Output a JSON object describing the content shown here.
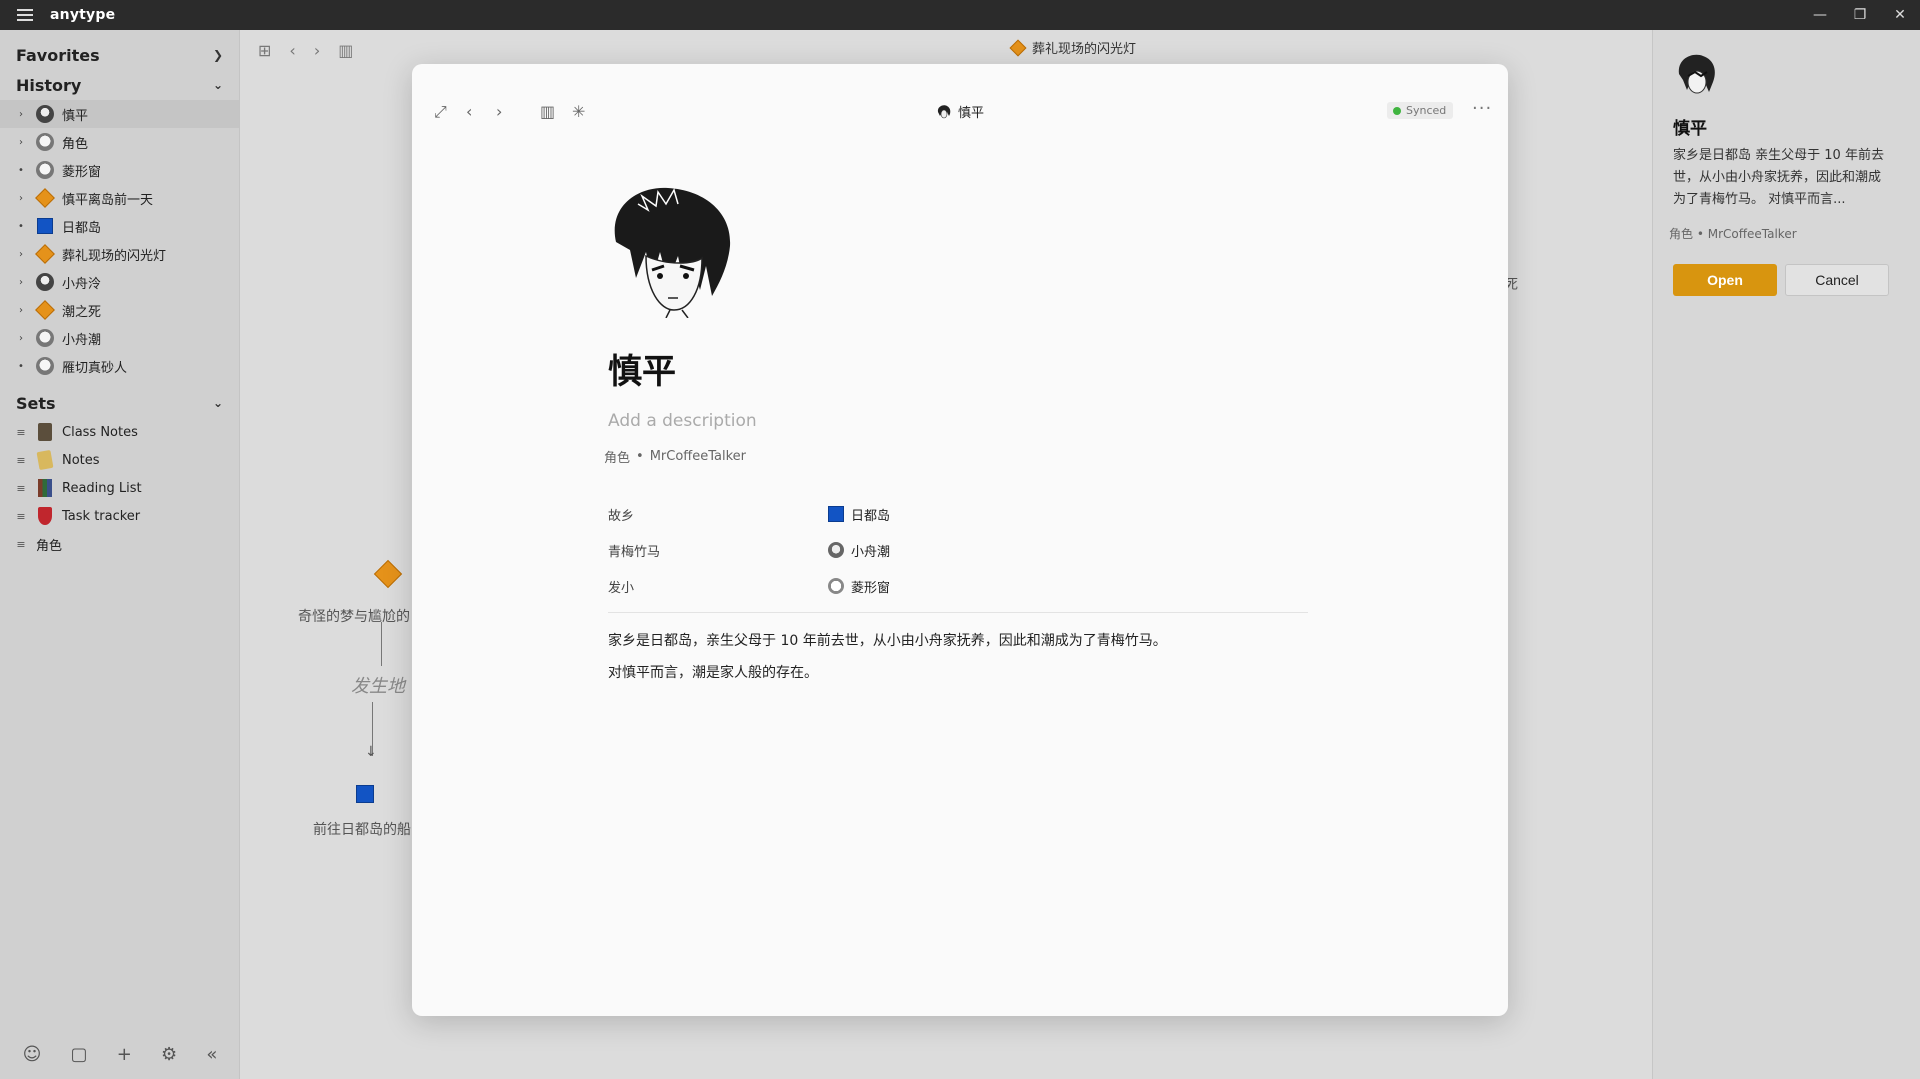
{
  "titlebar": {
    "app_name": "anytype"
  },
  "sidebar": {
    "favorites_label": "Favorites",
    "history_label": "History",
    "history_items": [
      {
        "label": "慎平",
        "icon": "avatar-icon",
        "active": true,
        "toggle": "›"
      },
      {
        "label": "角色",
        "icon": "person-icon",
        "toggle": "›"
      },
      {
        "label": "菱形窗",
        "icon": "avatar-icon",
        "toggle": "•"
      },
      {
        "label": "慎平离岛前一天",
        "icon": "diamond-icon",
        "toggle": "›"
      },
      {
        "label": "日都岛",
        "icon": "square-icon",
        "toggle": "•"
      },
      {
        "label": "葬礼现场的闪光灯",
        "icon": "diamond-icon",
        "toggle": "›"
      },
      {
        "label": "小舟泠",
        "icon": "avatar-icon",
        "toggle": "›"
      },
      {
        "label": "潮之死",
        "icon": "diamond-icon",
        "toggle": "›"
      },
      {
        "label": "小舟潮",
        "icon": "avatar-icon",
        "toggle": "›"
      },
      {
        "label": "雁切真砂人",
        "icon": "avatar-icon",
        "toggle": "•"
      }
    ],
    "sets_label": "Sets",
    "sets_items": [
      {
        "label": "Class Notes",
        "icon": "book-icon"
      },
      {
        "label": "Notes",
        "icon": "note-icon"
      },
      {
        "label": "Reading List",
        "icon": "books-icon"
      },
      {
        "label": "Task tracker",
        "icon": "pin-icon"
      },
      {
        "label": "角色",
        "icon": "none"
      }
    ]
  },
  "main": {
    "breadcrumb_title": "葬礼现场的闪光灯"
  },
  "graph": {
    "node1_label": "奇怪的梦与尴尬的",
    "edge_label": "发生地",
    "node2_label": "前往日都岛的船",
    "side_text": "死"
  },
  "modal": {
    "title": "慎平",
    "sync_status": "Synced",
    "page_title": "慎平",
    "description_placeholder": "Add a description",
    "type": "角色",
    "author": "MrCoffeeTalker",
    "relations": [
      {
        "key": "故乡",
        "value": "日都岛",
        "icon": "square-icon"
      },
      {
        "key": "青梅竹马",
        "value": "小舟潮",
        "icon": "avatar-icon"
      },
      {
        "key": "发小",
        "value": "菱形窗",
        "icon": "avatar-icon"
      }
    ],
    "body_line1": "家乡是日都岛，亲生父母于 10 年前去世，从小由小舟家抚养，因此和潮成为了青梅竹马。",
    "body_line2": "对慎平而言，潮是家人般的存在。"
  },
  "preview": {
    "title": "慎平",
    "description": "家乡是日都岛 亲生父母于 10 年前去世，从小由小舟家抚养，因此和潮成为了青梅竹马。 对慎平而言...",
    "type": "角色",
    "author": "MrCoffeeTalker",
    "open_label": "Open",
    "cancel_label": "Cancel"
  }
}
